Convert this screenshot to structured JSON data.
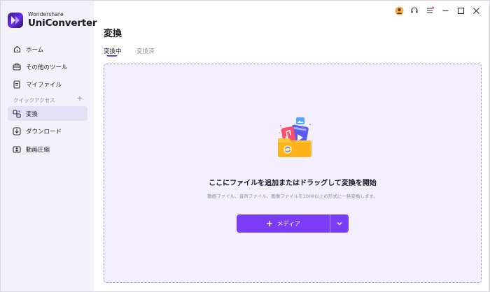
{
  "app": {
    "brand_sub": "Wondershare",
    "brand_main": "UniConverter"
  },
  "sidebar": {
    "items": [
      {
        "label": "ホーム",
        "icon": "home-icon"
      },
      {
        "label": "その他のツール",
        "icon": "toolbox-icon"
      },
      {
        "label": "マイファイル",
        "icon": "file-icon"
      }
    ],
    "quick_access_label": "クイックアクセス",
    "quick_items": [
      {
        "label": "変換",
        "icon": "convert-icon",
        "active": true
      },
      {
        "label": "ダウンロード",
        "icon": "download-icon"
      },
      {
        "label": "動画圧縮",
        "icon": "compress-icon"
      }
    ]
  },
  "main": {
    "title": "変換",
    "tabs": [
      {
        "label": "変換中",
        "active": true
      },
      {
        "label": "変換済",
        "active": false
      }
    ],
    "dropzone": {
      "title": "ここにファイルを追加またはドラッグして変換を開始",
      "subtitle": "動画ファイル、音声ファイル、画像ファイルを1000以上の形式に一括変換します。",
      "media_button": "メディア"
    }
  },
  "colors": {
    "accent": "#7a3cf5",
    "sidebar_bg": "#f3f1f9",
    "active_item_bg": "#e6e0f6",
    "dropzone_bg": "#f3effe"
  }
}
